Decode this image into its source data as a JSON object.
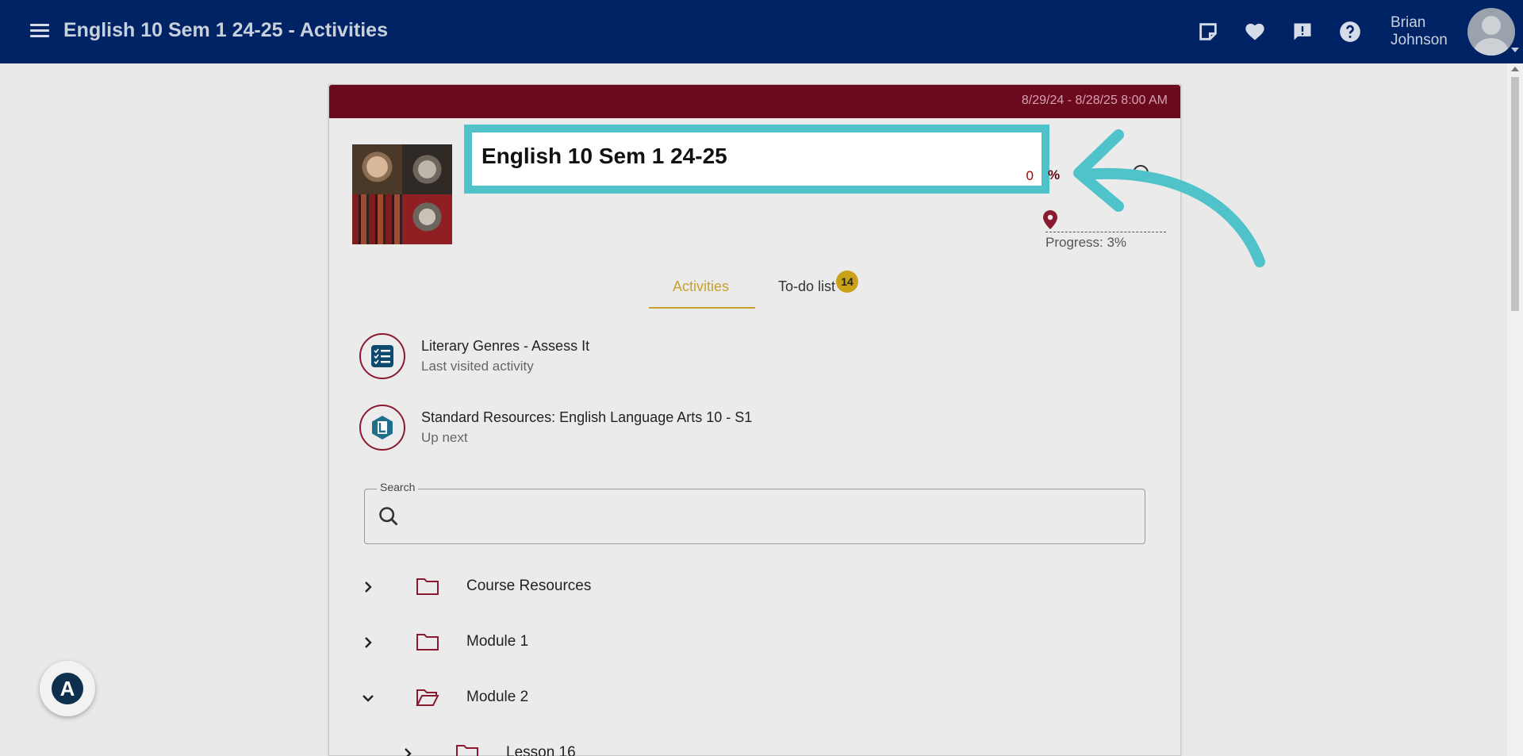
{
  "header": {
    "title": "English 10 Sem 1 24-25 - Activities",
    "user_first": "Brian",
    "user_last": "Johnson",
    "icons": [
      "notes-icon",
      "heart-icon",
      "feedback-icon",
      "help-icon"
    ]
  },
  "course": {
    "date_range": "8/29/24 - 8/28/25 8:00 AM",
    "title": "English 10 Sem 1 24-25",
    "grade_value": "0",
    "grade_unit": "%",
    "progress_label": "Progress: 3%",
    "progress": 0.03
  },
  "tabs": [
    {
      "label": "Activities",
      "active": true
    },
    {
      "label": "To-do list",
      "badge": "14"
    }
  ],
  "recent": [
    {
      "title": "Literary Genres - Assess It",
      "subtitle": "Last visited activity",
      "icon": "checklist-icon"
    },
    {
      "title": "Standard Resources: English Language Arts 10 - S1",
      "subtitle": "Up next",
      "icon": "resource-icon"
    }
  ],
  "search": {
    "label": "Search",
    "placeholder": ""
  },
  "tree": [
    {
      "label": "Course Resources",
      "expanded": false,
      "level": 0
    },
    {
      "label": "Module 1",
      "expanded": false,
      "level": 0
    },
    {
      "label": "Module 2",
      "expanded": true,
      "level": 0
    },
    {
      "label": "Lesson 16",
      "expanded": false,
      "level": 1
    }
  ],
  "colors": {
    "topbar": "#002366",
    "card_header": "#6b0a1f",
    "accent": "#c9a02a",
    "highlight": "#4fc3c9"
  }
}
